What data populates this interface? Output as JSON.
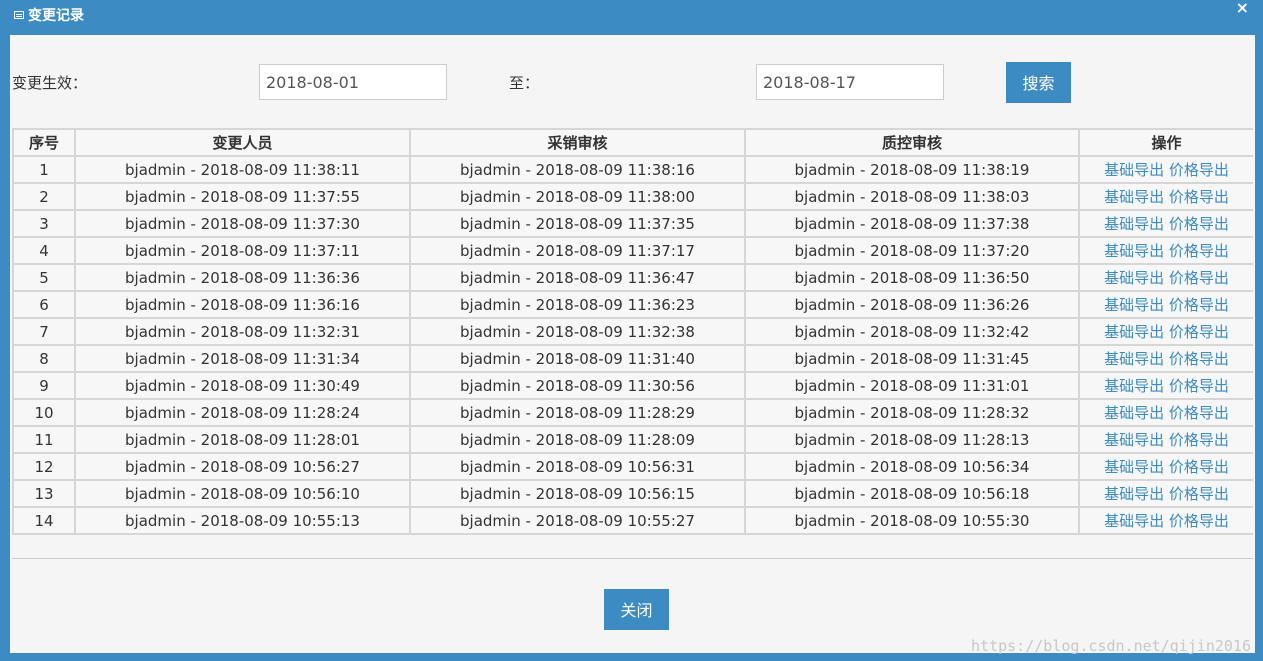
{
  "dialog": {
    "title": "变更记录",
    "close_symbol": "×"
  },
  "search": {
    "effective_label": "变更生效：",
    "start_date": "2018-08-01",
    "to_label": "至：",
    "end_date": "2018-08-17",
    "search_button": "搜索"
  },
  "table": {
    "headers": [
      "序号",
      "变更人员",
      "采销审核",
      "质控审核",
      "操作"
    ],
    "action_basic": "基础导出",
    "action_price": "价格导出",
    "rows": [
      {
        "no": "1",
        "changer": "bjadmin - 2018-08-09 11:38:11",
        "purchase": "bjadmin - 2018-08-09 11:38:16",
        "qc": "bjadmin - 2018-08-09 11:38:19"
      },
      {
        "no": "2",
        "changer": "bjadmin - 2018-08-09 11:37:55",
        "purchase": "bjadmin - 2018-08-09 11:38:00",
        "qc": "bjadmin - 2018-08-09 11:38:03"
      },
      {
        "no": "3",
        "changer": "bjadmin - 2018-08-09 11:37:30",
        "purchase": "bjadmin - 2018-08-09 11:37:35",
        "qc": "bjadmin - 2018-08-09 11:37:38"
      },
      {
        "no": "4",
        "changer": "bjadmin - 2018-08-09 11:37:11",
        "purchase": "bjadmin - 2018-08-09 11:37:17",
        "qc": "bjadmin - 2018-08-09 11:37:20"
      },
      {
        "no": "5",
        "changer": "bjadmin - 2018-08-09 11:36:36",
        "purchase": "bjadmin - 2018-08-09 11:36:47",
        "qc": "bjadmin - 2018-08-09 11:36:50"
      },
      {
        "no": "6",
        "changer": "bjadmin - 2018-08-09 11:36:16",
        "purchase": "bjadmin - 2018-08-09 11:36:23",
        "qc": "bjadmin - 2018-08-09 11:36:26"
      },
      {
        "no": "7",
        "changer": "bjadmin - 2018-08-09 11:32:31",
        "purchase": "bjadmin - 2018-08-09 11:32:38",
        "qc": "bjadmin - 2018-08-09 11:32:42"
      },
      {
        "no": "8",
        "changer": "bjadmin - 2018-08-09 11:31:34",
        "purchase": "bjadmin - 2018-08-09 11:31:40",
        "qc": "bjadmin - 2018-08-09 11:31:45"
      },
      {
        "no": "9",
        "changer": "bjadmin - 2018-08-09 11:30:49",
        "purchase": "bjadmin - 2018-08-09 11:30:56",
        "qc": "bjadmin - 2018-08-09 11:31:01"
      },
      {
        "no": "10",
        "changer": "bjadmin - 2018-08-09 11:28:24",
        "purchase": "bjadmin - 2018-08-09 11:28:29",
        "qc": "bjadmin - 2018-08-09 11:28:32"
      },
      {
        "no": "11",
        "changer": "bjadmin - 2018-08-09 11:28:01",
        "purchase": "bjadmin - 2018-08-09 11:28:09",
        "qc": "bjadmin - 2018-08-09 11:28:13"
      },
      {
        "no": "12",
        "changer": "bjadmin - 2018-08-09 10:56:27",
        "purchase": "bjadmin - 2018-08-09 10:56:31",
        "qc": "bjadmin - 2018-08-09 10:56:34"
      },
      {
        "no": "13",
        "changer": "bjadmin - 2018-08-09 10:56:10",
        "purchase": "bjadmin - 2018-08-09 10:56:15",
        "qc": "bjadmin - 2018-08-09 10:56:18"
      },
      {
        "no": "14",
        "changer": "bjadmin - 2018-08-09 10:55:13",
        "purchase": "bjadmin - 2018-08-09 10:55:27",
        "qc": "bjadmin - 2018-08-09 10:55:30"
      }
    ]
  },
  "footer": {
    "close_button": "关闭",
    "watermark": "https://blog.csdn.net/qijin2016"
  }
}
